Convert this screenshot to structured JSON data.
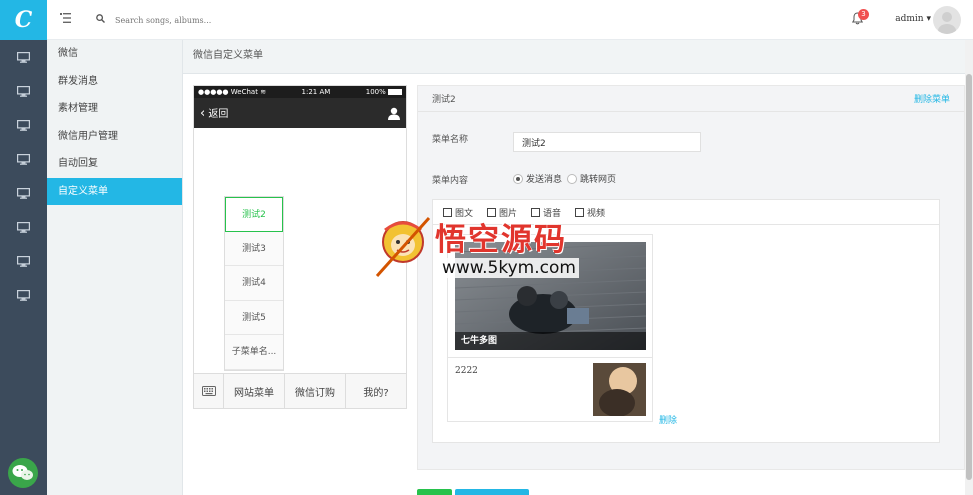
{
  "app": {
    "logo_letter": "C"
  },
  "topbar": {
    "search_placeholder": "Search songs, albums...",
    "notification_count": "3",
    "user_name": "admin"
  },
  "rail": {
    "icons": [
      "monitor-icon",
      "monitor-icon",
      "monitor-icon",
      "monitor-icon",
      "monitor-icon",
      "monitor-icon",
      "monitor-icon",
      "monitor-icon"
    ]
  },
  "subnav": {
    "items": [
      {
        "label": "微信",
        "active": false
      },
      {
        "label": "群发消息",
        "active": false
      },
      {
        "label": "素材管理",
        "active": false
      },
      {
        "label": "微信用户管理",
        "active": false
      },
      {
        "label": "自动回复",
        "active": false
      },
      {
        "label": "自定义菜单",
        "active": true
      }
    ]
  },
  "breadcrumb": "微信自定义菜单",
  "phone": {
    "status_left": "●●●●● WeChat",
    "status_time": "1:21 AM",
    "status_battery": "100%",
    "back_label": "返回",
    "submenu": [
      "测试2",
      "测试3",
      "测试4",
      "测试5",
      "子菜单名..."
    ],
    "selected_submenu": 0,
    "bottom_menu": [
      "网站菜单",
      "微信订购",
      "我的?"
    ]
  },
  "editor": {
    "header_title": "测试2",
    "delete_menu_label": "删除菜单",
    "name_label": "菜单名称",
    "name_value": "测试2",
    "content_label": "菜单内容",
    "radio_send": "发送消息",
    "radio_link": "跳转网页",
    "radio_selected": "send",
    "content_tabs": [
      "图文",
      "图片",
      "语音",
      "视频"
    ],
    "article": {
      "cover_title": "七牛多图",
      "item_title": "2222"
    },
    "delete_label": "删除"
  },
  "watermark": {
    "title": "悟空源码",
    "url": "www.5kym.com"
  },
  "colors": {
    "rail_bg": "#3c4b5c",
    "accent": "#23b7e5",
    "green": "#27c24c",
    "danger": "#f05050"
  }
}
